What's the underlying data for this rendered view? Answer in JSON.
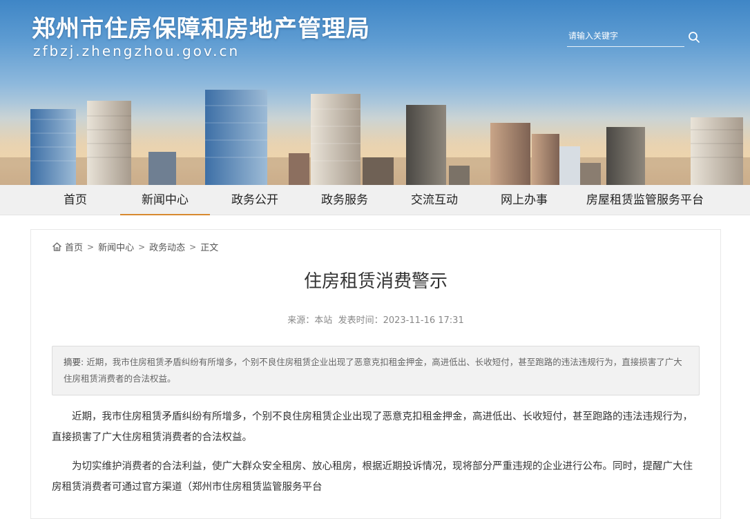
{
  "header": {
    "site_title": "郑州市住房保障和房地产管理局",
    "site_domain": "zfbzj.zhengzhou.gov.cn",
    "search_placeholder": "请输入关键字"
  },
  "nav": {
    "items": [
      "首页",
      "新闻中心",
      "政务公开",
      "政务服务",
      "交流互动",
      "网上办事",
      "房屋租赁监管服务平台"
    ],
    "active": "新闻中心",
    "accent_color": "#d7892f"
  },
  "breadcrumb": {
    "items": [
      "首页",
      "新闻中心",
      "政务动态",
      "正文"
    ],
    "separator": ">"
  },
  "article": {
    "title": "住房租赁消费警示",
    "source_label": "来源：",
    "source": "本站",
    "date_label": "发表时间：",
    "date": "2023-11-16 17:31",
    "abstract_label": "摘要:",
    "abstract_text": "近期，我市住房租赁矛盾纠纷有所增多，个别不良住房租赁企业出现了恶意克扣租金押金，高进低出、长收短付，甚至跑路的违法违规行为，直接损害了广大住房租赁消费者的合法权益。",
    "paragraph_1": "近期，我市住房租赁矛盾纠纷有所增多，个别不良住房租赁企业出现了恶意克扣租金押金，高进低出、长收短付，甚至跑路的违法违规行为，直接损害了广大住房租赁消费者的合法权益。",
    "paragraph_2": "为切实维护消费者的合法利益，使广大群众安全租房、放心租房，根据近期投诉情况，现将部分严重违规的企业进行公布。同时，提醒广大住房租赁消费者可通过官方渠道（郑州市住房租赁监管服务平台"
  },
  "icons": {
    "search": "search-icon",
    "home": "home-icon"
  }
}
